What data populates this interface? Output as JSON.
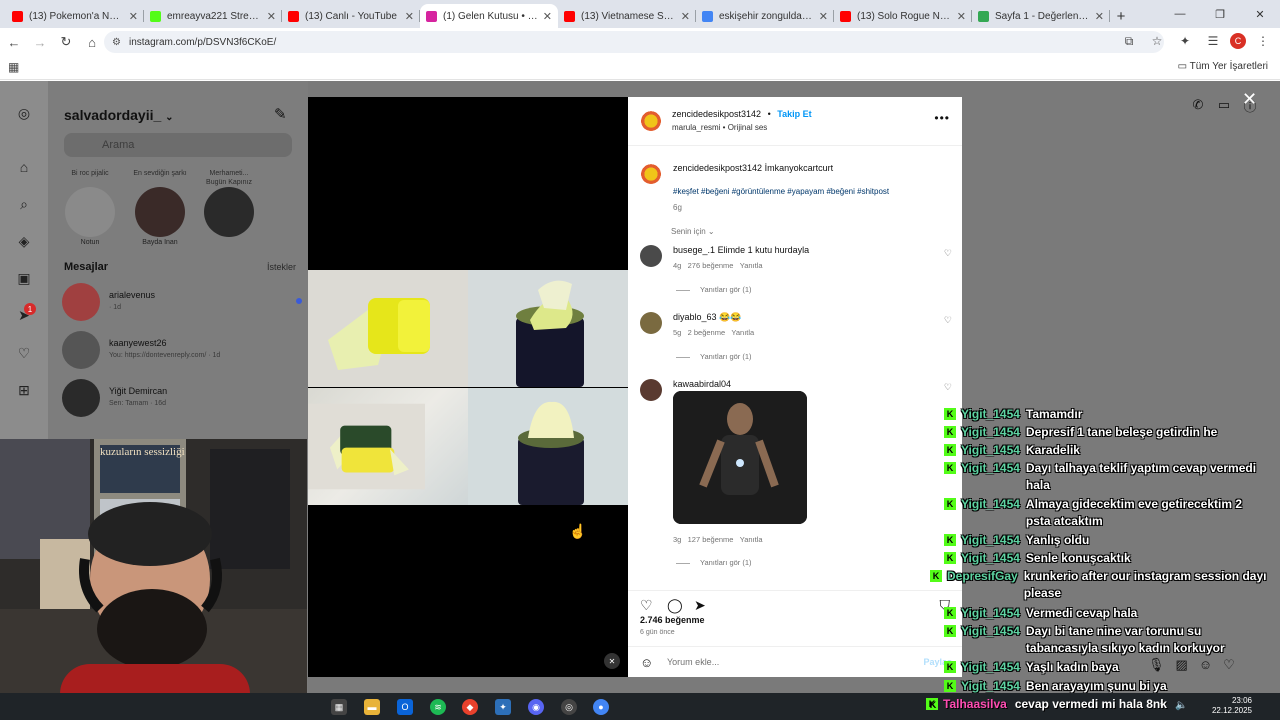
{
  "browser": {
    "tabs": [
      {
        "title": "(13) Pokemon'a Ne Oldu?",
        "favicon_color": "#ff0000",
        "active": false
      },
      {
        "title": "emreayva221 Stream - W...",
        "favicon_color": "#53fc18",
        "active": false
      },
      {
        "title": "(13) Canlı - YouTube",
        "favicon_color": "#ff0000",
        "active": false
      },
      {
        "title": "(1) Gelen Kutusu • Direct",
        "favicon_color": "#d6249f",
        "active": true
      },
      {
        "title": "(13) Vietnamese Seafood",
        "favicon_color": "#ff0000",
        "active": false
      },
      {
        "title": "eskişehir zonguldak - Go...",
        "favicon_color": "#4285f4",
        "active": false
      },
      {
        "title": "(13) Solo Rogue New Pat...",
        "favicon_color": "#ff0000",
        "active": false
      },
      {
        "title": "Sayfa 1 - Değerlendirme...",
        "favicon_color": "#34a853",
        "active": false
      }
    ],
    "url": "instagram.com/p/DSVN3f6CKoE/",
    "all_bookmarks": "Tüm Yer İşaretleri",
    "profile_initial": "C"
  },
  "inbox": {
    "username": "salvadordayii_",
    "search_placeholder": "Arama",
    "notes": [
      {
        "bubble": "Bi roc pijalic",
        "name": "Notun",
        "color": "#8a8a8a"
      },
      {
        "bubble": "En sevdiğin şarkı",
        "name": "Bayda Inan",
        "color": "#3a2a28"
      },
      {
        "bubble": "Merhameti... Bugün Kapınız",
        "name": "",
        "color": "#2a2a2a"
      }
    ],
    "messages_title": "Mesajlar",
    "requests_label": "İstekler",
    "conversations": [
      {
        "name": "arialevenus",
        "preview": "· 1d",
        "color": "#a04040",
        "unread": true
      },
      {
        "name": "kaanyewest26",
        "preview": "You: https://dontevenreply.com/ · 1d",
        "color": "#555555",
        "unread": false
      },
      {
        "name": "Yiğit Demircan",
        "preview": "Sen: Tamam · 16d",
        "color": "#2a2a2a",
        "unread": false
      }
    ],
    "notification_badge": "1"
  },
  "post": {
    "author": "zencidedesikpost3142",
    "follow_label": "Takip Et",
    "audio": "marula_resmi • Orijinal ses",
    "caption_user": "zencidedesikpost3142",
    "caption_text": "İmkanyokcartcurt",
    "hashtags": "#keşfet #beğeni #görüntülenme #yapayam #beğeni #shitpost",
    "caption_time": "6g",
    "for_you": "Senin için",
    "comments": [
      {
        "user": "busege_.1",
        "text": "Elimde 1 kutu hurdayla",
        "time": "4g",
        "likes": "276 beğenme",
        "reply": "Yanıtla",
        "view_replies": "Yanıtları gör (1)",
        "avatar_color": "#4a4a4a"
      },
      {
        "user": "diyablo_63",
        "text": "😂😂",
        "time": "5g",
        "likes": "2 beğenme",
        "reply": "Yanıtla",
        "view_replies": "Yanıtları gör (1)",
        "avatar_color": "#7a6a40"
      },
      {
        "user": "kawaabirdal04",
        "text": "",
        "time": "3g",
        "likes": "127 beğenme",
        "reply": "Yanıtla",
        "view_replies": "Yanıtları gör (1)",
        "avatar_color": "#5a3a30"
      }
    ],
    "likes_count": "2.746 beğenme",
    "posted_ago": "6 gün önce",
    "comment_placeholder": "Yorum ekle...",
    "share_label": "Paylaş"
  },
  "stream_chat": [
    {
      "user": "Yigit_1454",
      "text": "Tamamdır"
    },
    {
      "user": "Yigit_1454",
      "text": "Depresif 1 tane beleşe getirdin he"
    },
    {
      "user": "Yigit_1454",
      "text": "Karadelik"
    },
    {
      "user": "Yigit_1454",
      "text": "Dayı talhaya teklif yaptım cevap vermedi hala"
    },
    {
      "user": "Yigit_1454",
      "text": "Almaya gidecektim eve getirecektim 2 psta atcaktım"
    },
    {
      "user": "Yigit_1454",
      "text": "Yanlış oldu"
    },
    {
      "user": "Yigit_1454",
      "text": "Senle konuşcaktık"
    },
    {
      "user": "DepresifGay",
      "text": "krunkerio after our instagram session dayı please"
    },
    {
      "user": "Yigit_1454",
      "text": "Vermedi cevap hala"
    },
    {
      "user": "Yigit_1454",
      "text": "Dayı bi tane nine var torunu su tabancasıyla sıkıyo kadın korkuyor"
    },
    {
      "user": "Yigit_1454",
      "text": "Yaşlı kadın baya"
    },
    {
      "user": "Yigit_1454",
      "text": "Ben arayayım şunu bi ya"
    }
  ],
  "stream_follower": {
    "user": "Talhaasilva",
    "text": "cevap vermedi mi hala 8nk"
  },
  "webcam": {
    "poster_text": "kuzuların sessizliği"
  },
  "taskbar": {
    "time": "23:06",
    "date": "22.12.2025"
  },
  "colors": {
    "kick_green": "#53fc18",
    "ig_blue": "#0095f6",
    "chat_username": "#5ed3a2"
  }
}
